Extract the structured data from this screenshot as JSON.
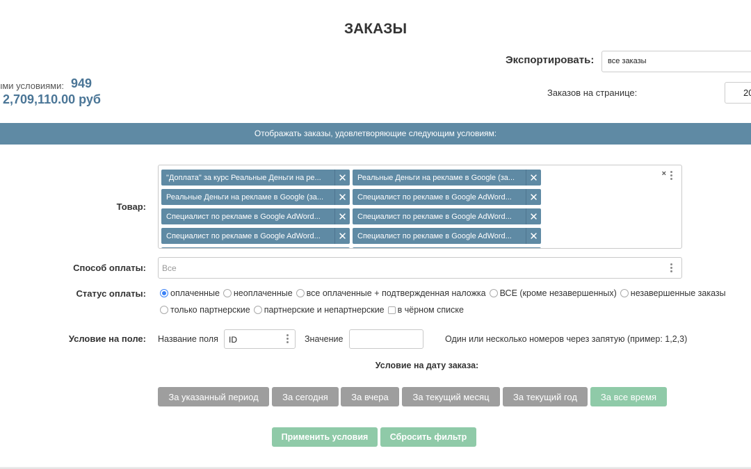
{
  "page": {
    "title": "ЗАКАЗЫ"
  },
  "stats": {
    "count_label": "ыми условиями:",
    "count_value": "949",
    "sum_value": "2,709,110.00 руб"
  },
  "export": {
    "label": "Экспортировать:",
    "selected": "все заказы"
  },
  "per_page": {
    "label": "Заказов на странице:",
    "value": "20"
  },
  "filter": {
    "banner": "Отображать заказы, удовлетворяющие следующим условиям:",
    "product": {
      "label": "Товар:",
      "tags": [
        "\"Доплата\" за курс Реальные Деньги на ре...",
        "Реальные Деньги на рекламе в Google (за...",
        "Реальные Деньги на рекламе в Google (за...",
        "Специалист по рекламе в Google AdWord...",
        "Специалист по рекламе в Google AdWord...",
        "Специалист по рекламе в Google AdWord...",
        "Специалист по рекламе в Google AdWord...",
        "Специалист по рекламе в Google AdWord..."
      ],
      "remove_symbol": "✕",
      "clear_symbol": "×"
    },
    "payment_method": {
      "label": "Способ оплаты:",
      "value": "Все"
    },
    "payment_status": {
      "label": "Статус оплаты:",
      "options_row1": [
        "оплаченные",
        "неоплаченные",
        "все оплаченные + подтвержденная наложка",
        "ВСЕ (кроме незавершенных)",
        "незавершенные заказы"
      ],
      "options_row2": [
        "только партнерские",
        "партнерские и непартнерские"
      ],
      "checkbox": "в чёрном списке",
      "selected": "оплаченные"
    },
    "field_condition": {
      "label": "Условие на поле:",
      "field_name_label": "Название поля",
      "field_name_value": "ID",
      "value_label": "Значение",
      "value": "",
      "hint": "Один или несколько номеров через запятую (пример: 1,2,3)"
    },
    "date_condition": {
      "title": "Условие на дату заказа:",
      "buttons": [
        "За указанный период",
        "За сегодня",
        "За вчера",
        "За текущий месяц",
        "За текущий год",
        "За все время"
      ],
      "active": "За все время"
    },
    "actions": {
      "apply": "Применить условия",
      "reset": "Сбросить фильтр"
    }
  },
  "colors": {
    "accent": "#5f8aa4",
    "stat_text": "#4a7596",
    "button_grey": "#9e9e9e",
    "button_green": "#8fcaa8",
    "radio_selected": "#3b82f6"
  }
}
